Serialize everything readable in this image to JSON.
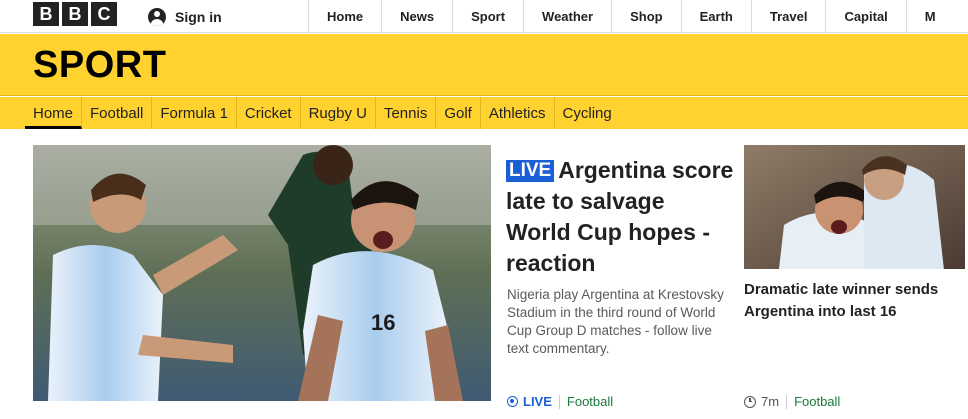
{
  "brand": {
    "letters": [
      "B",
      "B",
      "C"
    ]
  },
  "account": {
    "signin_label": "Sign in"
  },
  "topnav": [
    "Home",
    "News",
    "Sport",
    "Weather",
    "Shop",
    "Earth",
    "Travel",
    "Capital",
    "M"
  ],
  "section": {
    "title": "SPORT"
  },
  "secnav": [
    "Home",
    "Football",
    "Formula 1",
    "Cricket",
    "Rugby U",
    "Tennis",
    "Golf",
    "Athletics",
    "Cycling"
  ],
  "main_story": {
    "live_badge": "LIVE",
    "headline": "Argentina score late to salvage World Cup hopes - reaction",
    "summary": "Nigeria play Argentina at Krestovsky Stadium in the third round of World Cup Group D matches - follow live text commentary.",
    "meta_live": "LIVE",
    "meta_category": "Football"
  },
  "side_story": {
    "headline": "Dramatic late winner sends Argentina into last 16",
    "meta_time": "7m",
    "meta_category": "Football"
  },
  "colors": {
    "sport_yellow": "#ffd230",
    "live_blue": "#1a5fd6",
    "category_green": "#1a7a3c"
  }
}
